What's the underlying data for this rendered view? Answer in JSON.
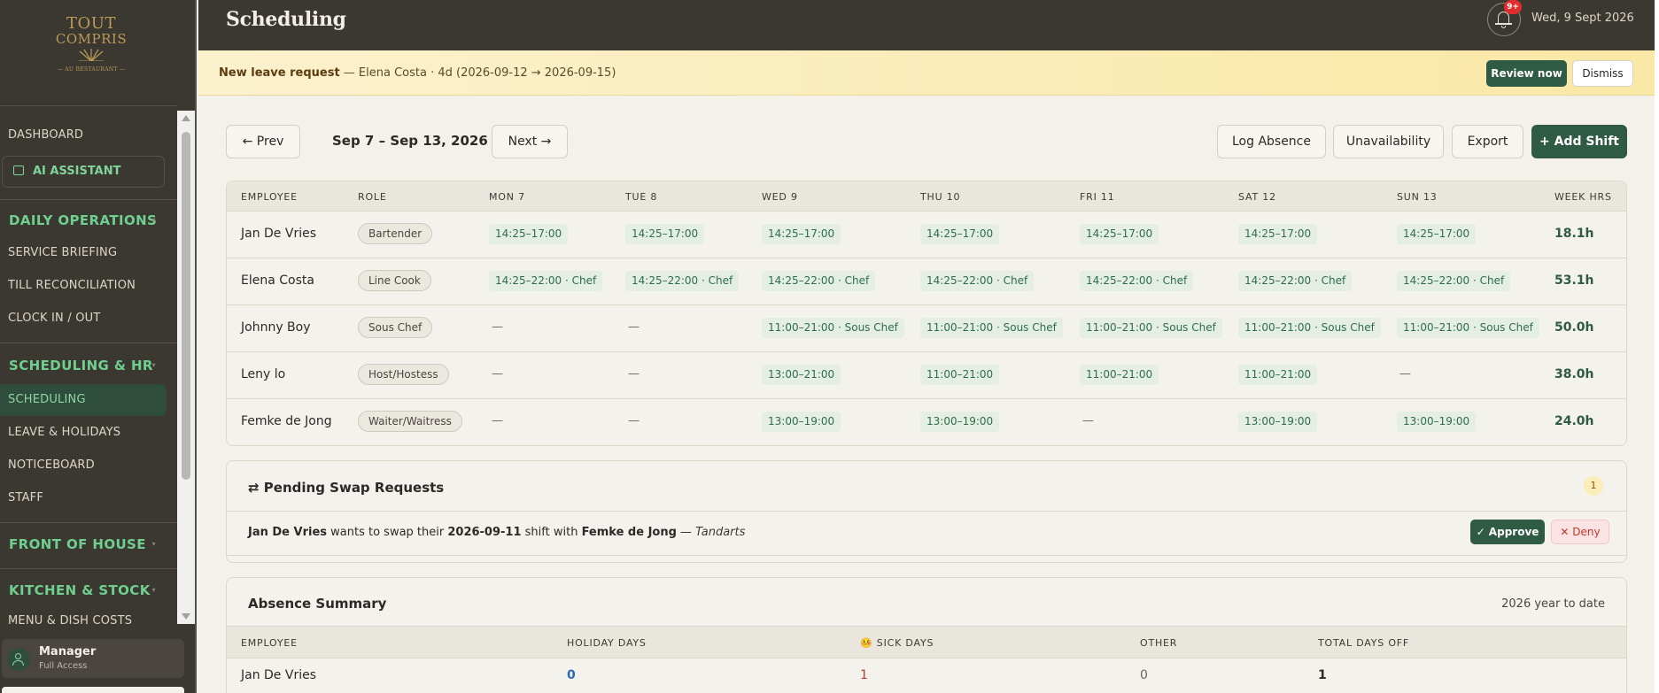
{
  "sidebar": {
    "logo": {
      "line1": "TOUT",
      "line2": "COMPRIS",
      "tagline": "— AU RESTAURANT —"
    },
    "items": [
      {
        "label": "DASHBOARD"
      },
      {
        "label": "AI ASSISTANT"
      },
      {
        "section": "DAILY OPERATIONS"
      },
      {
        "label": "SERVICE BRIEFING"
      },
      {
        "label": "TILL RECONCILIATION"
      },
      {
        "label": "CLOCK IN / OUT"
      },
      {
        "section": "SCHEDULING & HR"
      },
      {
        "label": "SCHEDULING",
        "active": true
      },
      {
        "label": "LEAVE & HOLIDAYS"
      },
      {
        "label": "NOTICEBOARD"
      },
      {
        "label": "STAFF"
      },
      {
        "section": "FRONT OF HOUSE"
      },
      {
        "section": "KITCHEN & STOCK"
      },
      {
        "label": "MENU & DISH COSTS"
      }
    ],
    "user": {
      "name": "Manager",
      "role": "Full Access"
    }
  },
  "topbar": {
    "title": "Scheduling",
    "notification_badge": "9+",
    "date": "Wed, 9 Sept 2026"
  },
  "banner": {
    "prefix": "New leave request",
    "detail": " — Elena Costa · 4d (2026-09-12 → 2026-09-15)",
    "review_label": "Review now",
    "dismiss_label": "Dismiss"
  },
  "toolbar": {
    "prev_label": "← Prev",
    "week_label": "Sep 7 – Sep 13, 2026",
    "next_label": "Next →",
    "log_absence_label": "Log Absence",
    "unavailability_label": "Unavailability",
    "export_label": "Export",
    "add_shift_label": "+ Add Shift"
  },
  "schedule": {
    "headers": [
      "EMPLOYEE",
      "ROLE",
      "MON 7",
      "TUE 8",
      "WED 9",
      "THU 10",
      "FRI 11",
      "SAT 12",
      "SUN 13",
      "WEEK HRS"
    ],
    "rows": [
      {
        "name": "Jan De Vries",
        "role": "Bartender",
        "shifts": [
          "14:25–17:00",
          "14:25–17:00",
          "14:25–17:00",
          "14:25–17:00",
          "14:25–17:00",
          "14:25–17:00",
          "14:25–17:00"
        ],
        "hours": "18.1h"
      },
      {
        "name": "Elena Costa",
        "role": "Line Cook",
        "shifts": [
          "14:25–22:00 · Chef",
          "14:25–22:00 · Chef",
          "14:25–22:00 · Chef",
          "14:25–22:00 · Chef",
          "14:25–22:00 · Chef",
          "14:25–22:00 · Chef",
          "14:25–22:00 · Chef"
        ],
        "hours": "53.1h"
      },
      {
        "name": "Johnny Boy",
        "role": "Sous Chef",
        "shifts": [
          "—",
          "—",
          "11:00–21:00 · Sous Chef",
          "11:00–21:00 · Sous Chef",
          "11:00–21:00 · Sous Chef",
          "11:00–21:00 · Sous Chef",
          "11:00–21:00 · Sous Chef"
        ],
        "hours": "50.0h"
      },
      {
        "name": "Leny lo",
        "role": "Host/Hostess",
        "shifts": [
          "—",
          "—",
          "13:00–21:00",
          "11:00–21:00",
          "11:00–21:00",
          "11:00–21:00",
          "—"
        ],
        "hours": "38.0h"
      },
      {
        "name": "Femke de Jong",
        "role": "Waiter/Waitress",
        "shifts": [
          "—",
          "—",
          "13:00–19:00",
          "13:00–19:00",
          "—",
          "13:00–19:00",
          "13:00–19:00"
        ],
        "hours": "24.0h"
      }
    ]
  },
  "swaps": {
    "title": "⇄ Pending Swap Requests",
    "count": "1",
    "request": {
      "requester": "Jan De Vries",
      "text1": " wants to swap their ",
      "date": "2026-09-11",
      "text2": " shift with ",
      "target": "Femke de Jong",
      "text3": " — ",
      "reason": "Tandarts"
    },
    "approve_label": "✓ Approve",
    "deny_label": "✕ Deny"
  },
  "absence": {
    "title": "Absence Summary",
    "period": "2026 year to date",
    "headers": [
      "EMPLOYEE",
      "HOLIDAY DAYS",
      "🤒 SICK DAYS",
      "OTHER",
      "TOTAL DAYS OFF"
    ],
    "rows": [
      {
        "name": "Jan De Vries",
        "holiday": "0",
        "sick": "1",
        "other": "0",
        "total": "1"
      }
    ],
    "colors": {
      "holiday": "#2a6bb3",
      "sick": "#c0392b"
    }
  }
}
